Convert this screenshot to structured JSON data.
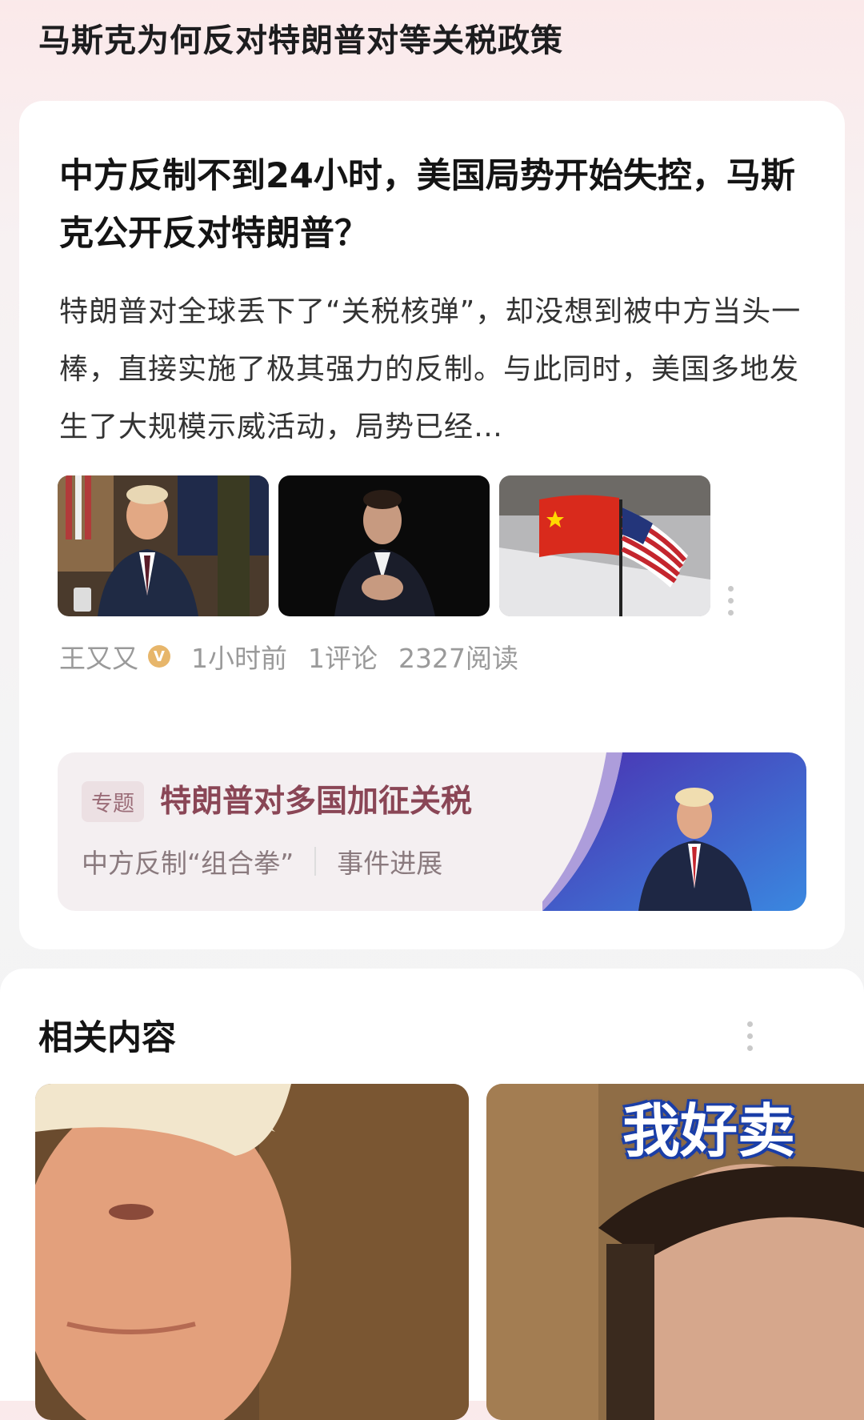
{
  "topic": {
    "title": "马斯克为何反对特朗普对等关税政策"
  },
  "article": {
    "headline": "中方反制不到24小时，美国局势开始失控，马斯克公开反对特朗普？",
    "summary": "特朗普对全球丢下了“关税核弹”，却没想到被中方当头一棒，直接实施了极其强力的反制。与此同时，美国多地发生了大规模示威活动，局势已经…",
    "thumbnails": [
      {
        "icon": "trump-photo-icon"
      },
      {
        "icon": "musk-photo-icon"
      },
      {
        "icon": "china-us-flags-icon"
      }
    ],
    "author": "王又又",
    "verified_mark": "V",
    "time": "1小时前",
    "comments": "1评论",
    "reads": "2327阅读"
  },
  "special": {
    "tag": "专题",
    "title": "特朗普对多国加征关税",
    "link1": "中方反制“组合拳”",
    "link2": "事件进展",
    "accent": "#8a4656"
  },
  "related": {
    "title": "相关内容",
    "card2_overlay": "我好卖"
  }
}
